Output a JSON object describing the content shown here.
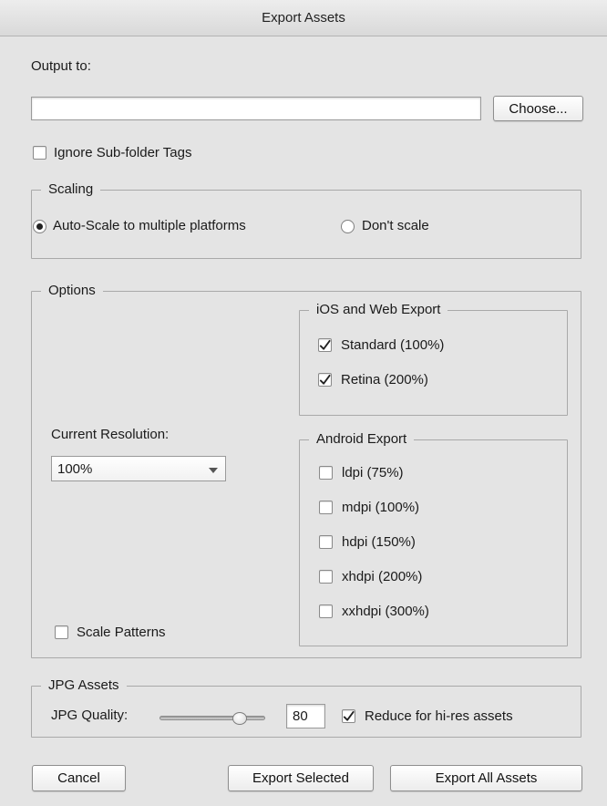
{
  "window": {
    "title": "Export Assets"
  },
  "output": {
    "label": "Output to:",
    "path_value": "",
    "choose_label": "Choose..."
  },
  "ignore_subfolder": {
    "label": "Ignore Sub-folder Tags",
    "checked": false
  },
  "scaling": {
    "legend": "Scaling",
    "options": [
      {
        "label": "Auto-Scale to multiple platforms",
        "selected": true
      },
      {
        "label": "Don't scale",
        "selected": false
      }
    ]
  },
  "options": {
    "legend": "Options",
    "current_resolution_label": "Current Resolution:",
    "current_resolution_value": "100%",
    "scale_patterns": {
      "label": "Scale Patterns",
      "checked": false
    },
    "ios": {
      "legend": "iOS and Web Export",
      "items": [
        {
          "label": "Standard (100%)",
          "checked": true
        },
        {
          "label": "Retina (200%)",
          "checked": true
        }
      ]
    },
    "android": {
      "legend": "Android Export",
      "items": [
        {
          "label": "ldpi (75%)",
          "checked": false
        },
        {
          "label": "mdpi (100%)",
          "checked": false
        },
        {
          "label": "hdpi (150%)",
          "checked": false
        },
        {
          "label": "xhdpi (200%)",
          "checked": false
        },
        {
          "label": "xxhdpi (300%)",
          "checked": false
        }
      ]
    }
  },
  "jpg": {
    "legend": "JPG Assets",
    "quality_label": "JPG Quality:",
    "quality_value": "80",
    "quality_fraction": 0.8,
    "reduce": {
      "label": "Reduce for hi-res assets",
      "checked": true
    }
  },
  "buttons": {
    "cancel": "Cancel",
    "export_selected": "Export Selected",
    "export_all": "Export All Assets"
  },
  "icons": {
    "checkmark": "checkmark-icon",
    "radio_dot": "radio-selected-icon",
    "dropdown": "chevron-down-icon"
  }
}
